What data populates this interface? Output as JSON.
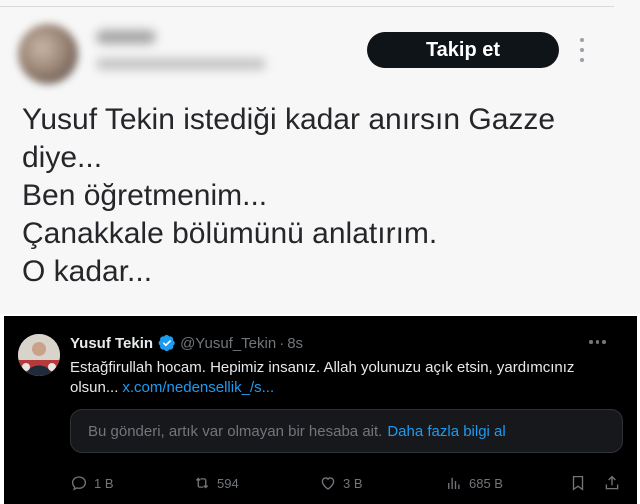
{
  "top_tweet": {
    "follow_label": "Takip et",
    "lines": [
      "Yusuf Tekin istediği kadar anırsın Gazze",
      "diye...",
      "Ben öğretmenim...",
      "Çanakkale bölümünü anlatırım.",
      "O kadar..."
    ]
  },
  "reply_tweet": {
    "author_name": "Yusuf Tekin",
    "handle": "@Yusuf_Tekin",
    "separator": "·",
    "time": "8s",
    "text_line1": "Estağfirullah hocam. Hepimiz insanız. Allah yolunuzu açık etsin, yardımcınız",
    "text_line2": "olsun...",
    "link": "x.com/nedensellik_/s...",
    "notice_text": "Bu gönderi, artık var olmayan bir hesaba ait.",
    "notice_link": "Daha fazla bilgi al",
    "actions": {
      "replies": "1 B",
      "reposts": "594",
      "likes": "3 B",
      "views": "685 B"
    }
  },
  "colors": {
    "dark_bg": "#000000",
    "link_blue": "#1d9bf0",
    "muted_gray": "#71767b",
    "follow_bg": "#0f1419"
  },
  "icons": [
    "more-vertical-icon",
    "verified-badge-icon",
    "more-horizontal-icon",
    "reply-icon",
    "repost-icon",
    "like-icon",
    "views-icon",
    "bookmark-icon",
    "share-icon"
  ]
}
